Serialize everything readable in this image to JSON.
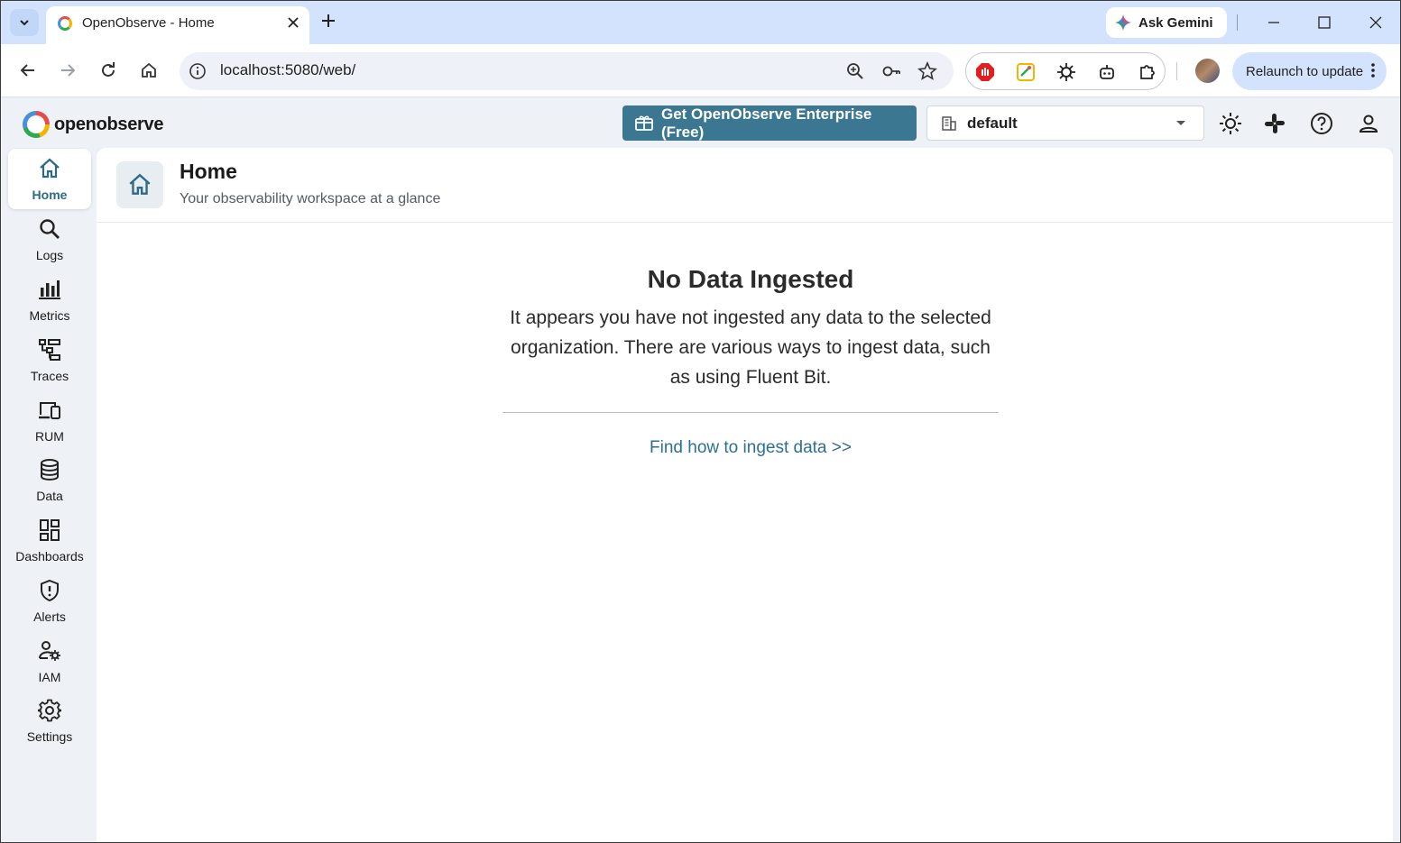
{
  "browser": {
    "tab_title": "OpenObserve - Home",
    "ask_gemini": "Ask Gemini",
    "url": "localhost:5080/web/",
    "relaunch": "Relaunch to update"
  },
  "app": {
    "logo_text": "openobserve",
    "enterprise_button": "Get OpenObserve Enterprise (Free)",
    "org_selected": "default"
  },
  "sidebar": {
    "items": [
      {
        "label": "Home",
        "icon": "home-icon",
        "active": true
      },
      {
        "label": "Logs",
        "icon": "search-icon"
      },
      {
        "label": "Metrics",
        "icon": "bar-chart-icon"
      },
      {
        "label": "Traces",
        "icon": "traces-icon"
      },
      {
        "label": "RUM",
        "icon": "devices-icon"
      },
      {
        "label": "Data",
        "icon": "database-icon"
      },
      {
        "label": "Dashboards",
        "icon": "dashboard-icon"
      },
      {
        "label": "Alerts",
        "icon": "shield-alert-icon"
      },
      {
        "label": "IAM",
        "icon": "users-gear-icon"
      },
      {
        "label": "Settings",
        "icon": "gear-icon"
      }
    ]
  },
  "page": {
    "title": "Home",
    "subtitle": "Your observability workspace at a glance"
  },
  "empty_state": {
    "title": "No Data Ingested",
    "text": "It appears you have not ingested any data to the selected organization. There are various ways to ingest data, such as using Fluent Bit.",
    "link": "Find how to ingest data >>"
  },
  "colors": {
    "accent": "#3b7790",
    "link": "#2e6f91",
    "tabstrip": "#d3e3fd"
  }
}
